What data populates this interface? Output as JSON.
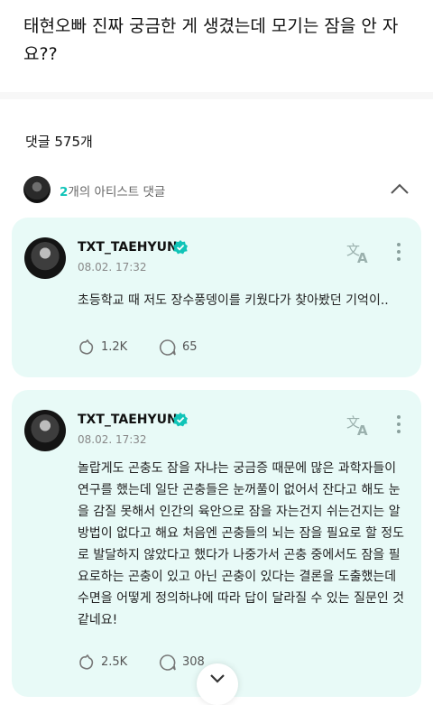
{
  "post": {
    "title": "태현오빠 진짜 궁금한 게 생겼는데 모기는 잠을 안 자요??"
  },
  "comments_header": {
    "count_label": "댓글 575개"
  },
  "artist_section": {
    "count": "2",
    "label": "개의 아티스트 댓글",
    "accent_color": "#10c4b8"
  },
  "comments": [
    {
      "author": "TXT_TAEHYUN",
      "date": "08.02. 17:32",
      "text": "초등학교 때 저도 장수풍뎅이를 키웠다가  찾아봤던 기억이..",
      "likes": "1.2K",
      "replies": "65"
    },
    {
      "author": "TXT_TAEHYUN",
      "date": "08.02. 17:32",
      "text": "놀랍게도 곤충도 잠을 자냐는 궁금증 때문에 많은 과학자들이 연구를 했는데 일단 곤충들은 눈꺼풀이 없어서 잔다고 해도 눈을 감질 못해서 인간의 육안으로 잠을 자는건지 쉬는건지는 알 방법이 없다고 해요 처음엔 곤충들의 뇌는 잠을 필요로 할 정도로 발달하지 않았다고 했다가 나중가서 곤충 중에서도 잠을 필요로하는 곤충이 있고 아닌 곤충이 있다는 결론을 도출했는데 수면을 어떻게 정의하냐에 따라 답이 달라질 수 있는 질문인 것 같네요!",
      "likes": "2.5K",
      "replies": "308"
    }
  ],
  "colors": {
    "card_bg": "#e8faf7",
    "accent": "#10c4b8",
    "verified": "#10c4b8"
  },
  "icons": [
    "translate-icon",
    "more-vert-icon",
    "cheer-icon",
    "reply-bubble-icon",
    "verified-badge-icon",
    "chevron-up-icon",
    "chevron-down-icon"
  ]
}
